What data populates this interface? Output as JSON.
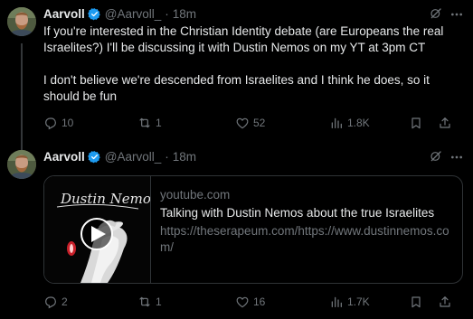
{
  "tweets": [
    {
      "author": {
        "name": "Aarvoll",
        "handle": "@Aarvoll_",
        "verified": true
      },
      "time": "18m",
      "paragraphs": [
        "If you're interested in the Christian Identity debate (are Europeans the real Israelites?) I'll be discussing it with Dustin Nemos on my YT at 3pm CT",
        "I don't believe we're descended from Israelites and I think he does, so it should be fun"
      ],
      "stats": {
        "replies": "10",
        "reposts": "1",
        "likes": "52",
        "views": "1.8K"
      }
    },
    {
      "author": {
        "name": "Aarvoll",
        "handle": "@Aarvoll_",
        "verified": true
      },
      "time": "18m",
      "card": {
        "domain": "youtube.com",
        "title": "Talking with Dustin Nemos about the true Israelites",
        "url": "https://theserapeum.com/https://www.dustinnemos.com/",
        "thumbnail_text": "Dustin Nemos"
      },
      "stats": {
        "replies": "2",
        "reposts": "1",
        "likes": "16",
        "views": "1.7K"
      }
    }
  ],
  "icons": {
    "verified": "verified-badge-icon",
    "grok": "grok-icon",
    "more": "more-icon",
    "reply": "reply-icon",
    "repost": "repost-icon",
    "like": "like-icon",
    "views": "views-icon",
    "bookmark": "bookmark-icon",
    "share": "share-icon"
  },
  "colors": {
    "background": "#000000",
    "text": "#e7e9ea",
    "secondary": "#71767b",
    "verified": "#1d9bf0",
    "border": "#2f3336"
  }
}
